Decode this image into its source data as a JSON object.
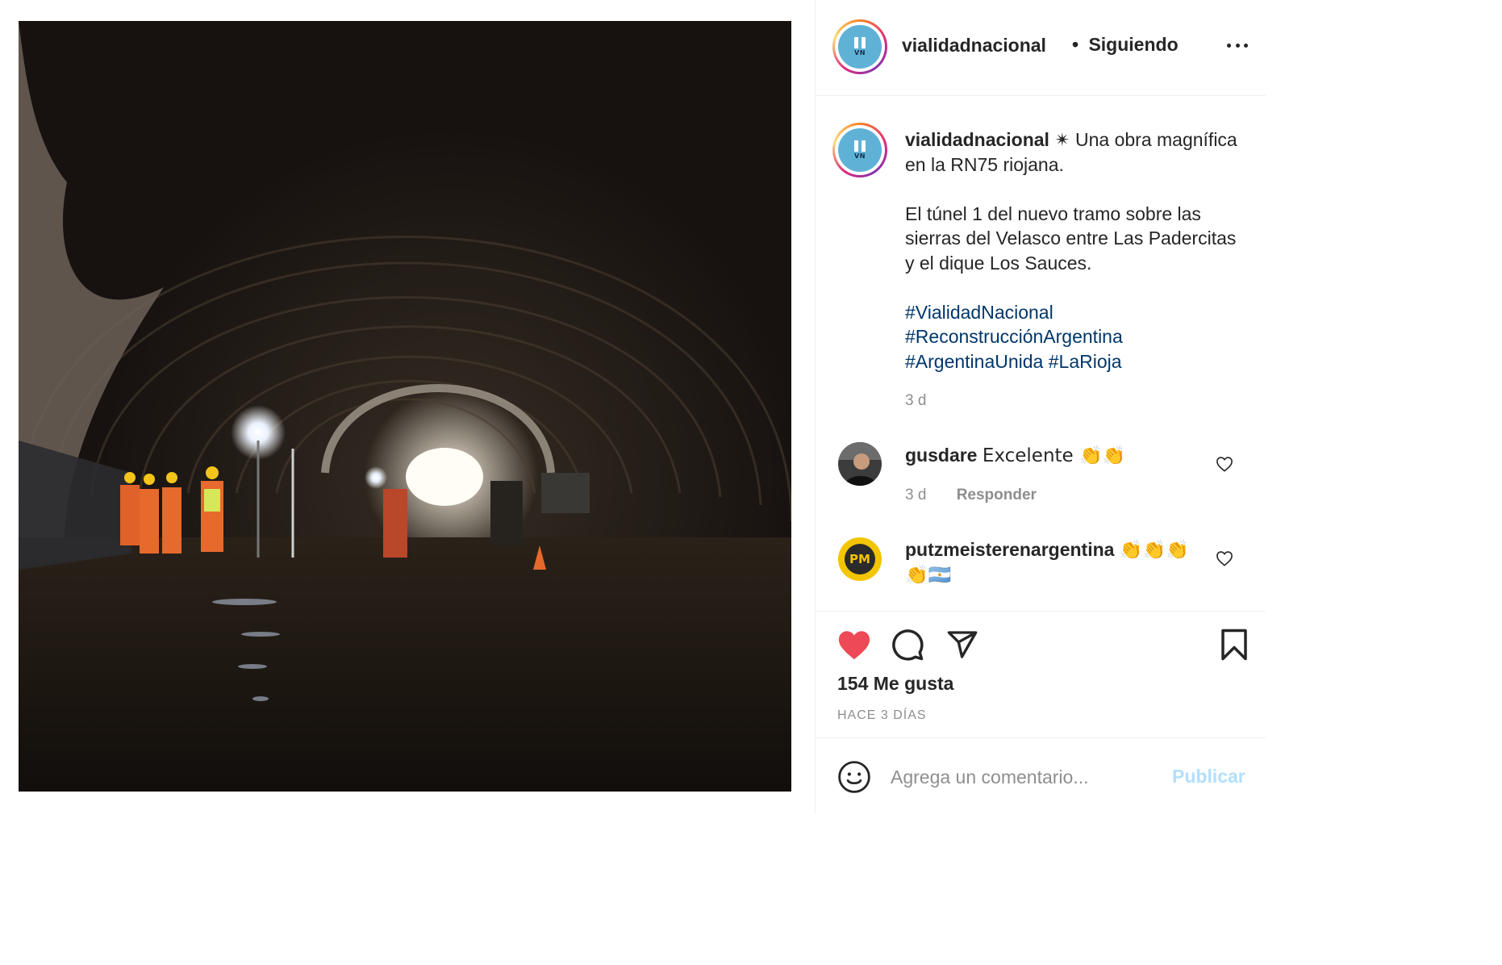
{
  "post": {
    "username": "vialidadnacional",
    "follow_status": "Siguiendo",
    "avatar_text": "VN",
    "caption": {
      "username": "vialidadnacional",
      "line1": "✴︎ Una obra magnífica en la RN75 riojana.",
      "line2": "El túnel 1 del nuevo tramo sobre las sierras del Velasco entre Las Padercitas y el dique Los Sauces.",
      "hashtags": [
        "#VialidadNacional",
        "#ReconstrucciónArgentina",
        "#ArgentinaUnida",
        "#LaRioja"
      ],
      "time": "3 d"
    },
    "comments": [
      {
        "username": "gusdare",
        "text": "Excelente 👏👏",
        "time": "3 d",
        "reply_label": "Responder"
      },
      {
        "username": "putzmeisterenargentina",
        "text": "👏👏👏👏🇦🇷",
        "avatar_text": "PM"
      }
    ],
    "likes_label": "154 Me gusta",
    "posted_ago": "HACE 3 DÍAS",
    "comment_placeholder": "Agrega un comentario...",
    "publish_label": "Publicar"
  },
  "colors": {
    "like_red": "#ed4956",
    "hashtag_blue": "#00376b",
    "publish_disabled": "#b2dffc",
    "muted_text": "#8e8e8e",
    "avatar_blue": "#5fb2d6"
  },
  "icons": {
    "like": "heart-filled-icon",
    "comment": "speech-bubble-icon",
    "share": "paper-plane-icon",
    "save": "bookmark-icon",
    "more": "ellipsis-icon",
    "emoji": "smiley-icon"
  }
}
